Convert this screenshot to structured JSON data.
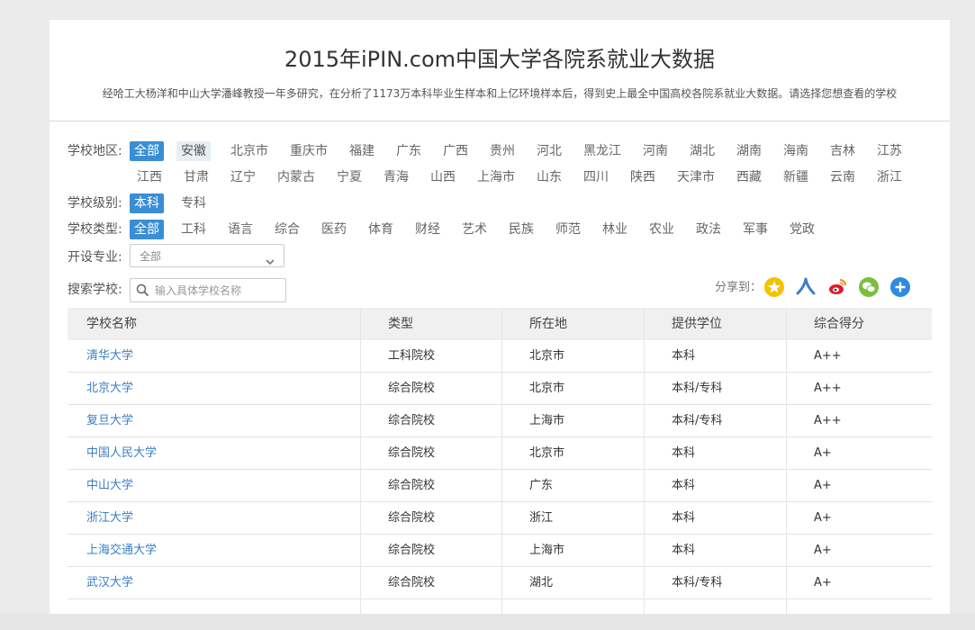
{
  "header": {
    "title": "2015年iPIN.com中国大学各院系就业大数据",
    "subtitle": "经哈工大杨洋和中山大学潘峰教授一年多研究，在分析了1173万本科毕业生样本和上亿环境样本后，得到史上最全中国高校各院系就业大数据。请选择您想查看的学校"
  },
  "filters": {
    "region_label": "学校地区:",
    "regions": [
      "全部",
      "安徽",
      "北京市",
      "重庆市",
      "福建",
      "广东",
      "广西",
      "贵州",
      "河北",
      "黑龙江",
      "河南",
      "湖北",
      "湖南",
      "海南",
      "吉林",
      "江苏",
      "江西",
      "甘肃",
      "辽宁",
      "内蒙古",
      "宁夏",
      "青海",
      "山西",
      "上海市",
      "山东",
      "四川",
      "陕西",
      "天津市",
      "西藏",
      "新疆",
      "云南",
      "浙江"
    ],
    "region_selected": "全部",
    "region_hovered": "安徽",
    "level_label": "学校级别:",
    "levels": [
      "本科",
      "专科"
    ],
    "level_selected": "本科",
    "type_label": "学校类型:",
    "types": [
      "全部",
      "工科",
      "语言",
      "综合",
      "医药",
      "体育",
      "财经",
      "艺术",
      "民族",
      "师范",
      "林业",
      "农业",
      "政法",
      "军事",
      "党政"
    ],
    "type_selected": "全部",
    "major_label": "开设专业:",
    "major_value": "全部",
    "search_label": "搜索学校:",
    "search_placeholder": "输入具体学校名称",
    "search_value": ""
  },
  "share": {
    "label": "分享到：",
    "icons": [
      {
        "name": "qzone-icon",
        "color": "#f5c200"
      },
      {
        "name": "renren-icon",
        "color": "#3f7ec9"
      },
      {
        "name": "weibo-icon",
        "color": "#e6162d"
      },
      {
        "name": "wechat-icon",
        "color": "#7bbf3e"
      },
      {
        "name": "more-icon",
        "color": "#2d8be0"
      }
    ]
  },
  "table": {
    "columns": [
      "学校名称",
      "类型",
      "所在地",
      "提供学位",
      "综合得分"
    ],
    "rows": [
      [
        "清华大学",
        "工科院校",
        "北京市",
        "本科",
        "A++"
      ],
      [
        "北京大学",
        "综合院校",
        "北京市",
        "本科/专科",
        "A++"
      ],
      [
        "复旦大学",
        "综合院校",
        "上海市",
        "本科/专科",
        "A++"
      ],
      [
        "中国人民大学",
        "综合院校",
        "北京市",
        "本科",
        "A+"
      ],
      [
        "中山大学",
        "综合院校",
        "广东",
        "本科",
        "A+"
      ],
      [
        "浙江大学",
        "综合院校",
        "浙江",
        "本科",
        "A+"
      ],
      [
        "上海交通大学",
        "综合院校",
        "上海市",
        "本科",
        "A+"
      ],
      [
        "武汉大学",
        "综合院校",
        "湖北",
        "本科/专科",
        "A+"
      ]
    ]
  }
}
